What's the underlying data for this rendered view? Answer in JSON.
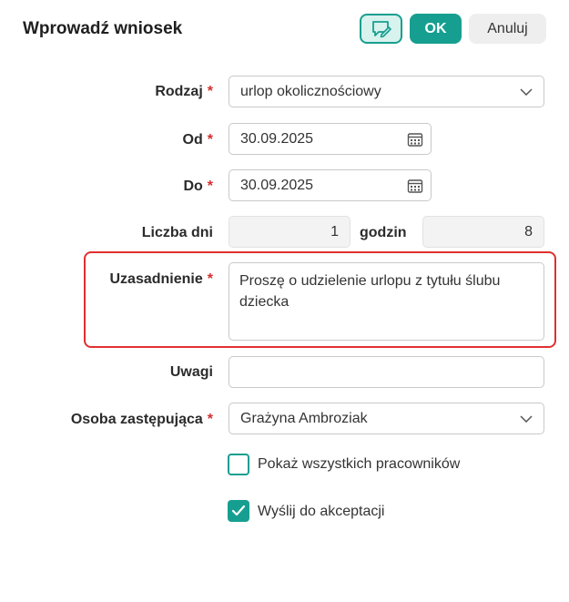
{
  "dialog": {
    "title": "Wprowadź wniosek",
    "ok_label": "OK",
    "cancel_label": "Anuluj",
    "note_icon": "comment-edit-icon",
    "accent_color": "#169f90",
    "highlight_color": "#e0302f"
  },
  "form": {
    "rodzaj": {
      "label": "Rodzaj",
      "required_mark": "*",
      "value": "urlop okolicznościowy"
    },
    "od": {
      "label": "Od",
      "required_mark": "*",
      "value": "30.09.2025"
    },
    "do": {
      "label": "Do",
      "required_mark": "*",
      "value": "30.09.2025"
    },
    "liczba_dni": {
      "label": "Liczba dni",
      "value": "1"
    },
    "godzin": {
      "label": "godzin",
      "value": "8"
    },
    "uzasadnienie": {
      "label": "Uzasadnienie",
      "required_mark": "*",
      "value": "Proszę o udzielenie urlopu z tytułu ślubu dziecka"
    },
    "uwagi": {
      "label": "Uwagi",
      "value": ""
    },
    "osoba": {
      "label": "Osoba zastępująca",
      "required_mark": "*",
      "value": "Grażyna Ambroziak"
    },
    "pokaz_wszystkich": {
      "label": "Pokaż wszystkich pracowników",
      "checked": false
    },
    "wyslij": {
      "label": "Wyślij do akceptacji",
      "checked": true
    }
  }
}
